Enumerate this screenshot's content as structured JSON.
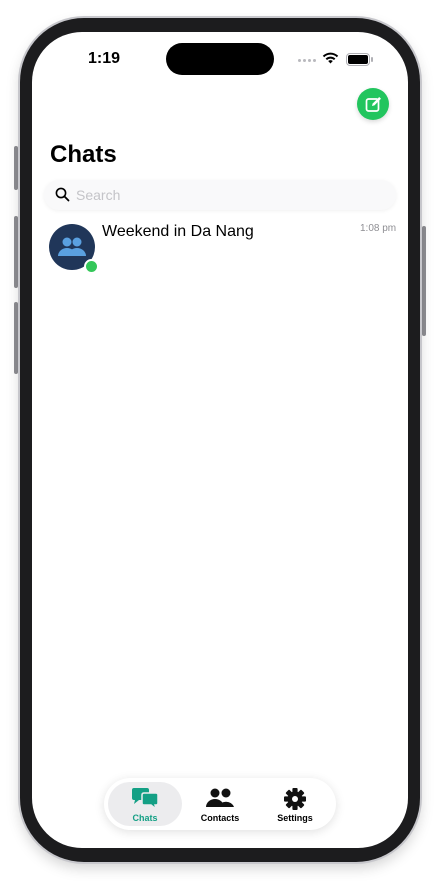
{
  "status_bar": {
    "time": "1:19"
  },
  "header": {
    "title": "Chats",
    "compose_icon": "compose-icon"
  },
  "search": {
    "placeholder": "Search"
  },
  "chats": [
    {
      "name": "Weekend in Da Nang",
      "time": "1:08 pm",
      "avatar_icon": "group-icon",
      "online": true
    }
  ],
  "tabs": [
    {
      "label": "Chats",
      "icon": "chat-bubbles-icon",
      "active": true
    },
    {
      "label": "Contacts",
      "icon": "contacts-icon",
      "active": false
    },
    {
      "label": "Settings",
      "icon": "gear-icon",
      "active": false
    }
  ],
  "colors": {
    "accent": "#22c55e",
    "active_tab": "#14a085",
    "avatar_bg": "#203659",
    "online": "#34c759"
  }
}
